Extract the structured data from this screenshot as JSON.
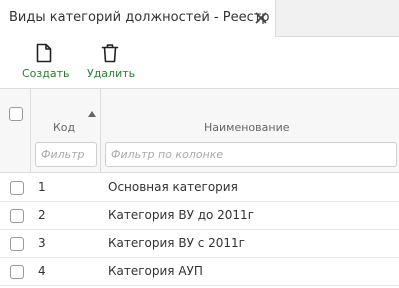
{
  "tab": {
    "title": "Виды категорий должностей - Реестр"
  },
  "toolbar": {
    "create_label": "Создать",
    "delete_label": "Удалить"
  },
  "grid": {
    "columns": [
      {
        "label": "Код",
        "filter_placeholder": "Фильтр",
        "sort": "ascending"
      },
      {
        "label": "Наименование",
        "filter_placeholder": "Фильтр по колонке"
      }
    ],
    "rows": [
      {
        "code": "1",
        "name": "Основная категория"
      },
      {
        "code": "2",
        "name": "Категория ВУ до 2011г"
      },
      {
        "code": "3",
        "name": "Категория ВУ с 2011г"
      },
      {
        "code": "4",
        "name": "Категория АУП"
      }
    ]
  }
}
